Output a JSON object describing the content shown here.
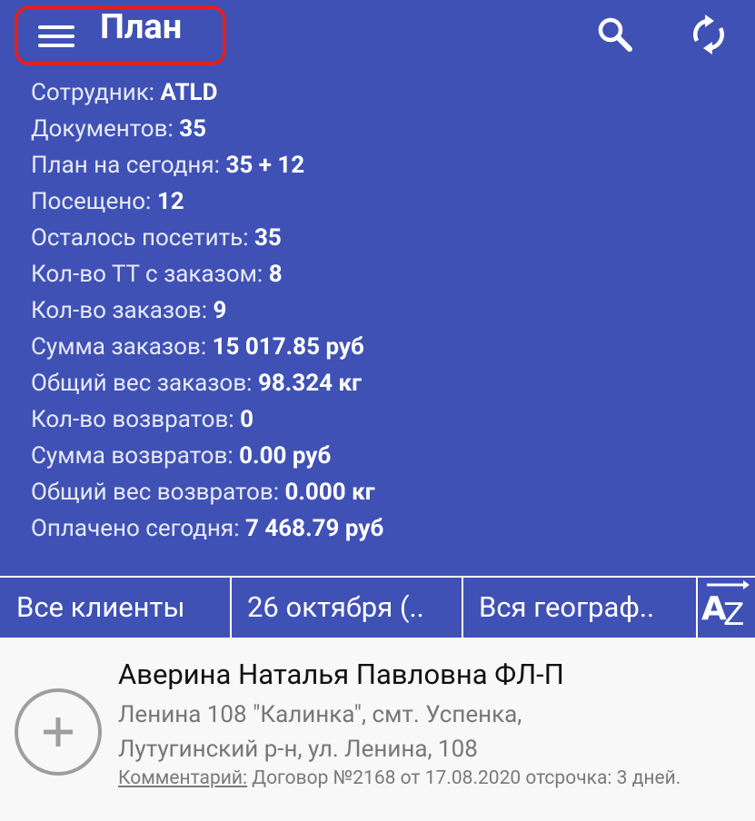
{
  "header": {
    "title": "План",
    "icons": {
      "menu": "hamburger-menu-icon",
      "search": "search-icon",
      "sync": "sync-icon"
    }
  },
  "stats": [
    {
      "label": "Сотрудник: ",
      "value": "ATLD"
    },
    {
      "label": "Документов: ",
      "value": "35"
    },
    {
      "label": "План на сегодня: ",
      "value": "35 + 12"
    },
    {
      "label": "Посещено: ",
      "value": "12"
    },
    {
      "label": "Осталось посетить: ",
      "value": "35"
    },
    {
      "label": "Кол-во ТТ с заказом: ",
      "value": "8"
    },
    {
      "label": "Кол-во заказов: ",
      "value": "9"
    },
    {
      "label": "Сумма заказов: ",
      "value": "15 017.85 руб"
    },
    {
      "label": "Общий вес заказов: ",
      "value": "98.324 кг"
    },
    {
      "label": "Кол-во возвратов: ",
      "value": "0"
    },
    {
      "label": "Сумма возвратов: ",
      "value": "0.00 руб"
    },
    {
      "label": "Общий вес возвратов: ",
      "value": "0.000 кг"
    },
    {
      "label": "Оплачено сегодня: ",
      "value": "7 468.79 руб"
    }
  ],
  "filters": {
    "clients": "Все клиенты",
    "date": "26 октября (..",
    "geo": "Вся географ..",
    "sort_icon": "sort-az-icon"
  },
  "client": {
    "name": "Аверина Наталья Павловна ФЛ-П",
    "address_line1": "Ленина 108 \"Калинка\", смт. Успенка,",
    "address_line2": "Лутугинский р-н, ул. Ленина, 108",
    "comment_label": "Комментарий:",
    "comment_text": " Договор №2168 от 17.08.2020 отсрочка: 3 дней.",
    "add_icon": "plus-icon"
  },
  "colors": {
    "primary": "#3f51b5",
    "highlight": "#e02020",
    "background": "#f8f8f8"
  }
}
